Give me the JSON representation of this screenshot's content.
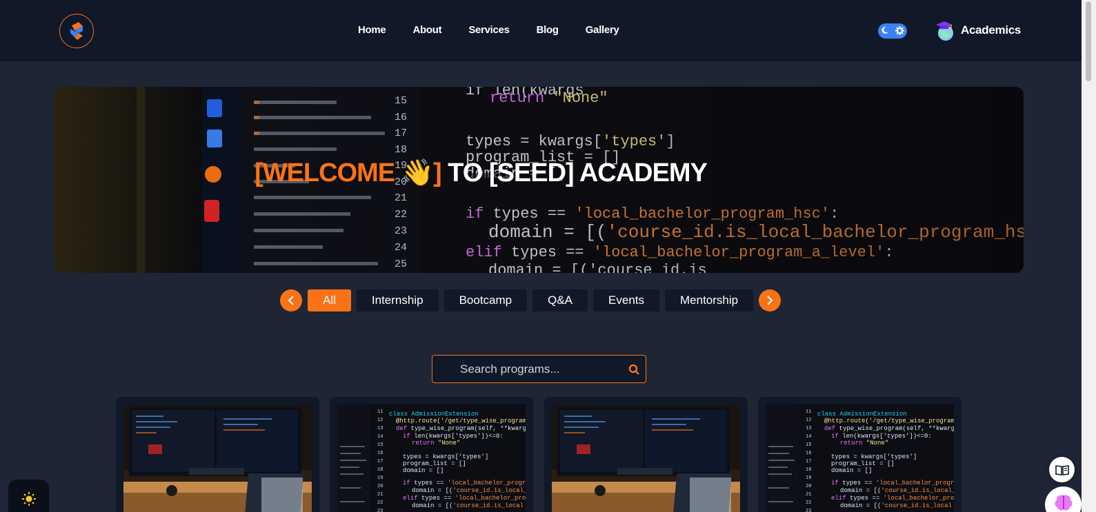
{
  "header": {
    "logo_icon": "seed-logo-icon",
    "nav": [
      {
        "label": "Home"
      },
      {
        "label": "About"
      },
      {
        "label": "Services"
      },
      {
        "label": "Blog"
      },
      {
        "label": "Gallery"
      }
    ],
    "theme_toggle": {
      "moon_icon": "moon-icon",
      "gear_icon": "gear-icon"
    },
    "academics_label": "Academics",
    "academics_icon": "graduation-cap-globe-icon"
  },
  "hero": {
    "title_part1": "[WELCOME ",
    "title_emoji": "👋",
    "title_part2": "]",
    "title_part3": " TO [SEED] ACADEMY"
  },
  "filters": {
    "prev_icon": "chevron-left-icon",
    "next_icon": "chevron-right-icon",
    "tabs": [
      {
        "label": "All",
        "active": true
      },
      {
        "label": "Internship"
      },
      {
        "label": "Bootcamp"
      },
      {
        "label": "Q&A"
      },
      {
        "label": "Events"
      },
      {
        "label": "Mentorship"
      }
    ]
  },
  "search": {
    "placeholder": "Search programs...",
    "value": "",
    "icon": "search-icon"
  },
  "cards": [
    {
      "image": "desk-monitors-image"
    },
    {
      "image": "code-screen-image"
    },
    {
      "image": "desk-monitors-image"
    },
    {
      "image": "code-screen-image"
    }
  ],
  "floating": {
    "sun_icon": "sun-icon",
    "book_icon": "book-open-icon",
    "brain_icon": "brain-icon"
  },
  "colors": {
    "accent": "#f97316",
    "header_bg": "#111827",
    "page_bg": "#1e2535",
    "toggle": "#3b82f6"
  }
}
